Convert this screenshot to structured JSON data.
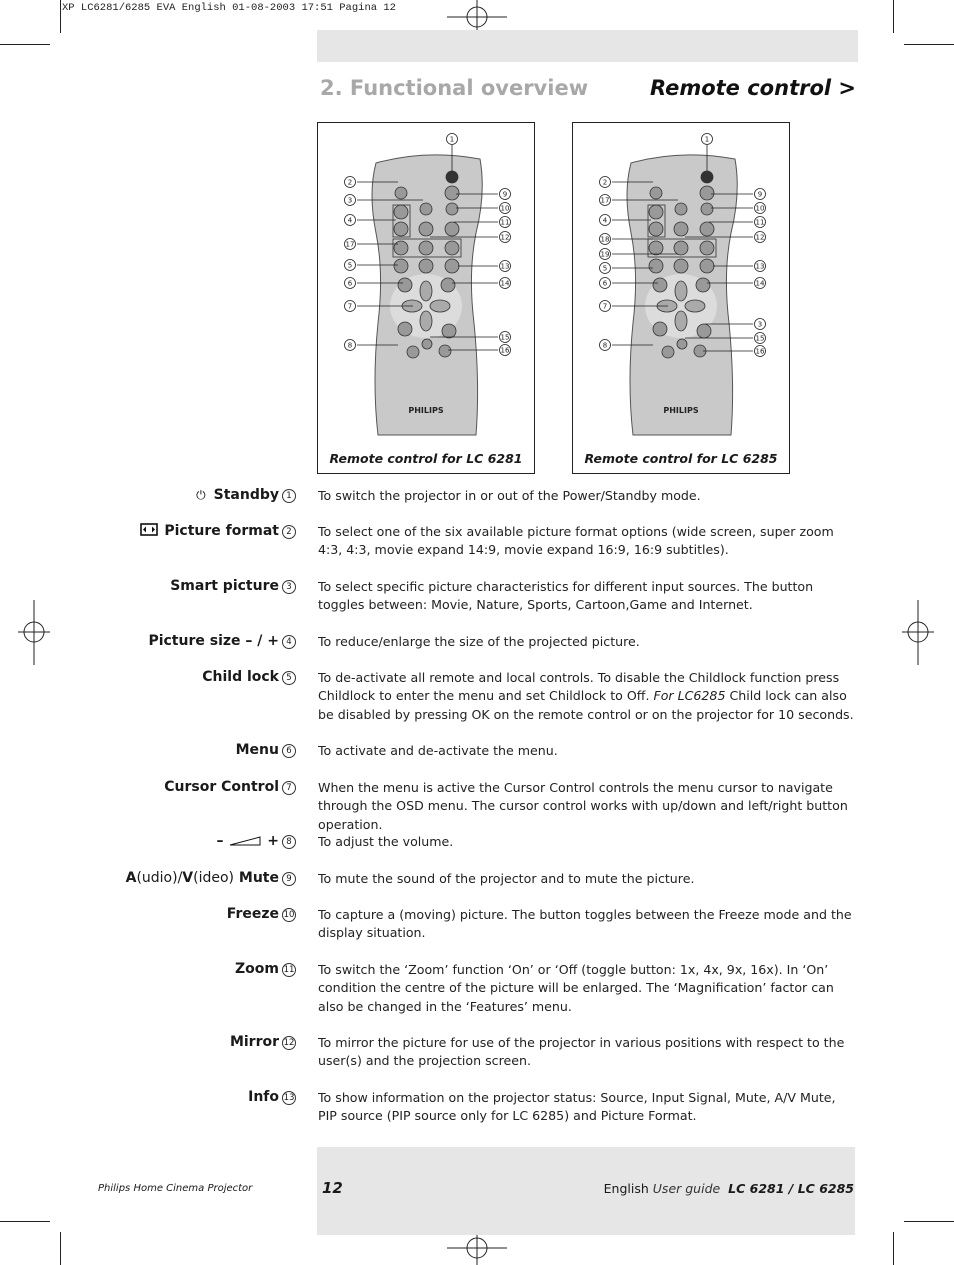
{
  "print_slug": "XP LC6281/6285 EVA English  01-08-2003  17:51  Pagina 12",
  "header": {
    "section_title": "2. Functional overview",
    "page_topic": "Remote control >"
  },
  "remotes": [
    {
      "caption": "Remote control for LC 6281",
      "brand": "PHILIPS",
      "left_callouts": [
        "2",
        "3",
        "4",
        "17",
        "5",
        "6",
        "7",
        "8"
      ],
      "right_callouts": [
        "9",
        "10",
        "11",
        "12",
        "13",
        "14",
        "15",
        "16"
      ],
      "top_callout": "1"
    },
    {
      "caption": "Remote control for LC 6285",
      "brand": "PHILIPS",
      "left_callouts": [
        "2",
        "17",
        "4",
        "18",
        "19",
        "5",
        "6",
        "7",
        "8"
      ],
      "right_callouts": [
        "9",
        "10",
        "11",
        "12",
        "13",
        "14",
        "3",
        "15",
        "16"
      ],
      "top_callout": "1"
    }
  ],
  "functions": [
    {
      "icon": "power-icon",
      "label": "Standby",
      "num": "1",
      "desc": "To switch the projector in or out of the Power/Standby mode."
    },
    {
      "icon": "picture-format-icon",
      "label": "Picture format",
      "num": "2",
      "desc": "To select one of the six available picture format options (wide screen, super zoom 4:3, 4:3, movie expand 14:9, movie expand 16:9, 16:9 subtitles)."
    },
    {
      "label": "Smart picture",
      "num": "3",
      "desc": "To select specific picture characteristics for different input sources. The button toggles between: Movie, Nature, Sports, Cartoon,Game and Internet."
    },
    {
      "label": "Picture size – / +",
      "num": "4",
      "desc": "To reduce/enlarge the size of the projected picture."
    },
    {
      "label": "Child lock",
      "num": "5",
      "desc_a": "To de-activate all remote and local controls. To disable the Childlock function press Childlock to enter the menu and set Childlock to Off. ",
      "desc_em": "For LC6285",
      "desc_b": " Child lock can also be disabled by pressing OK on the remote control or on the projector for 10 seconds."
    },
    {
      "label": "Menu",
      "num": "6",
      "desc": "To activate and de-activate the menu."
    },
    {
      "label": "Cursor Control",
      "num": "7",
      "desc": "When the menu is active the Cursor Control controls the menu cursor to navigate through the OSD menu. The cursor control works with up/down and left/right button operation."
    },
    {
      "icon": "volume-icon",
      "label_minus": "–",
      "label_plus": "+",
      "num": "8",
      "desc": "To adjust the volume."
    },
    {
      "label_a": "A",
      "label_a2": "(udio)/",
      "label_v": "V",
      "label_v2": "(ideo)",
      "label_m": " Mute",
      "num": "9",
      "desc": "To mute the sound of the projector and to mute the picture."
    },
    {
      "label": "Freeze",
      "num": "10",
      "desc": "To capture a (moving) picture. The button toggles between the Freeze mode and the display situation."
    },
    {
      "label": "Zoom",
      "num": "11",
      "desc": "To switch the ‘Zoom’ function ‘On’ or ‘Off (toggle button: 1x, 4x, 9x, 16x). In ‘On’ condition the centre of the picture will be enlarged. The ‘Magnification’ factor can also be changed in the ‘Features’ menu."
    },
    {
      "label": "Mirror",
      "num": "12",
      "desc": "To mirror the picture for use of the projector in various positions with respect to the user(s) and the projection screen."
    },
    {
      "label": "Info",
      "num": "13",
      "desc": "To show information on the projector status: Source, Input Signal, Mute, A/V Mute, PIP source (PIP source only for LC 6285) and Picture Format."
    }
  ],
  "footer": {
    "product": "Philips Home Cinema Projector",
    "page_number": "12",
    "language": "English",
    "guide": "User guide",
    "models": "LC 6281 / LC 6285"
  }
}
